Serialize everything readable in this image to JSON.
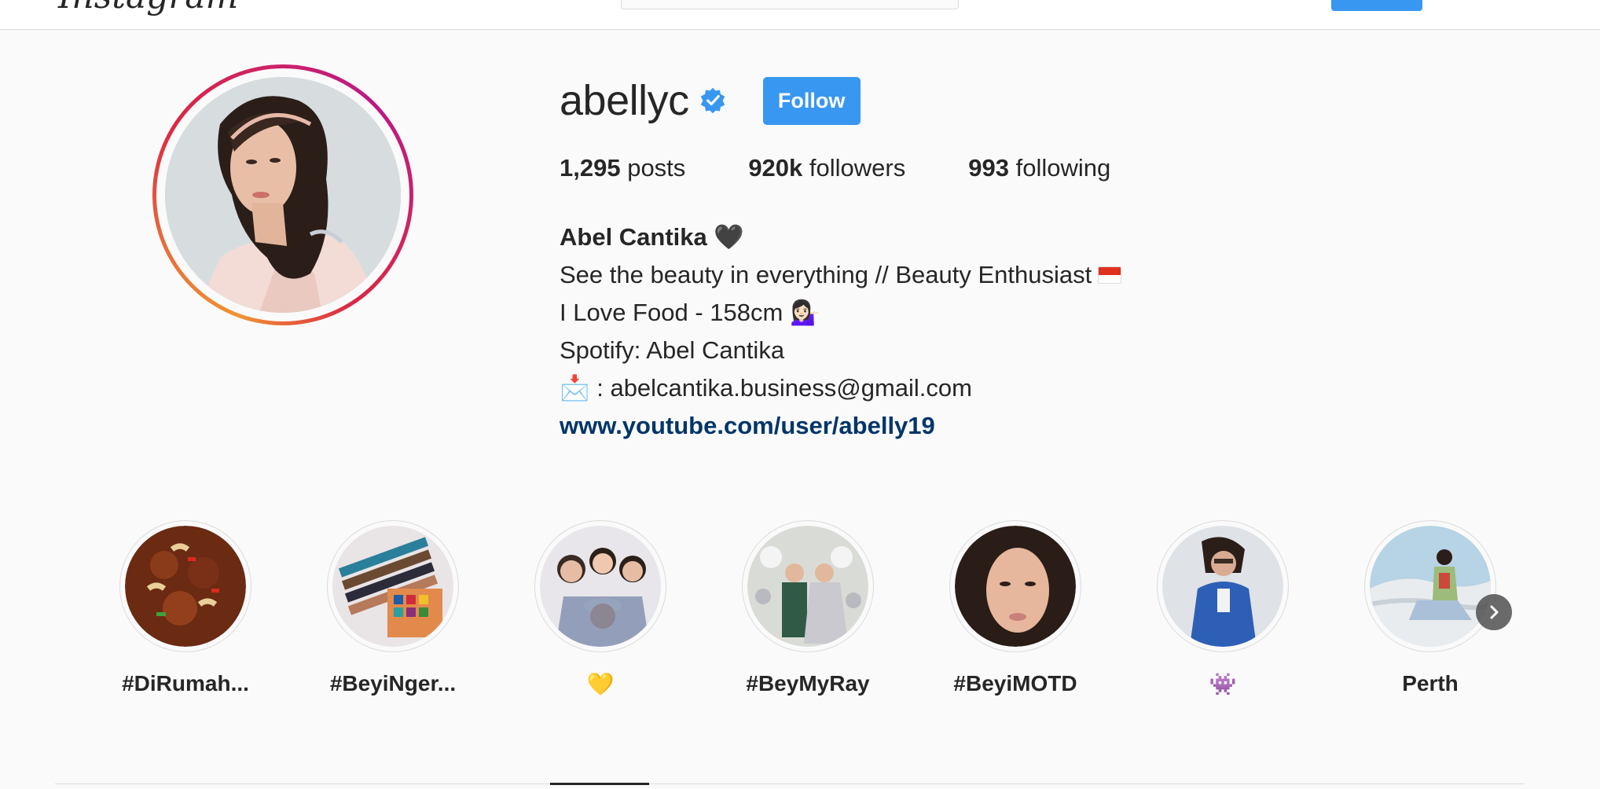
{
  "header": {
    "logo_text": "Instagram"
  },
  "profile": {
    "username": "abellyc",
    "verified": true,
    "follow_label": "Follow",
    "stats": {
      "posts_count": "1,295",
      "posts_label": "posts",
      "followers_count": "920k",
      "followers_label": "followers",
      "following_count": "993",
      "following_label": "following"
    },
    "bio": {
      "full_name": "Abel Cantika",
      "name_emoji": "🖤",
      "line1": "See the beauty in everything // Beauty Enthusiast",
      "line2": "I Love Food - 158cm",
      "line2_emoji": "💁🏻‍♀️",
      "line3": "Spotify: Abel Cantika",
      "line4_emoji": "📩",
      "line4": " : abelcantika.business@gmail.com",
      "website": "www.youtube.com/user/abelly19"
    }
  },
  "highlights": [
    {
      "label": "#DiRumah..."
    },
    {
      "label": "#BeyiNger..."
    },
    {
      "label": "💛"
    },
    {
      "label": "#BeyMyRay"
    },
    {
      "label": "#BeyiMOTD"
    },
    {
      "label": "👾"
    },
    {
      "label": "Perth"
    }
  ],
  "colors": {
    "accent": "#3897f0",
    "link": "#003569",
    "background": "#fafafa"
  }
}
